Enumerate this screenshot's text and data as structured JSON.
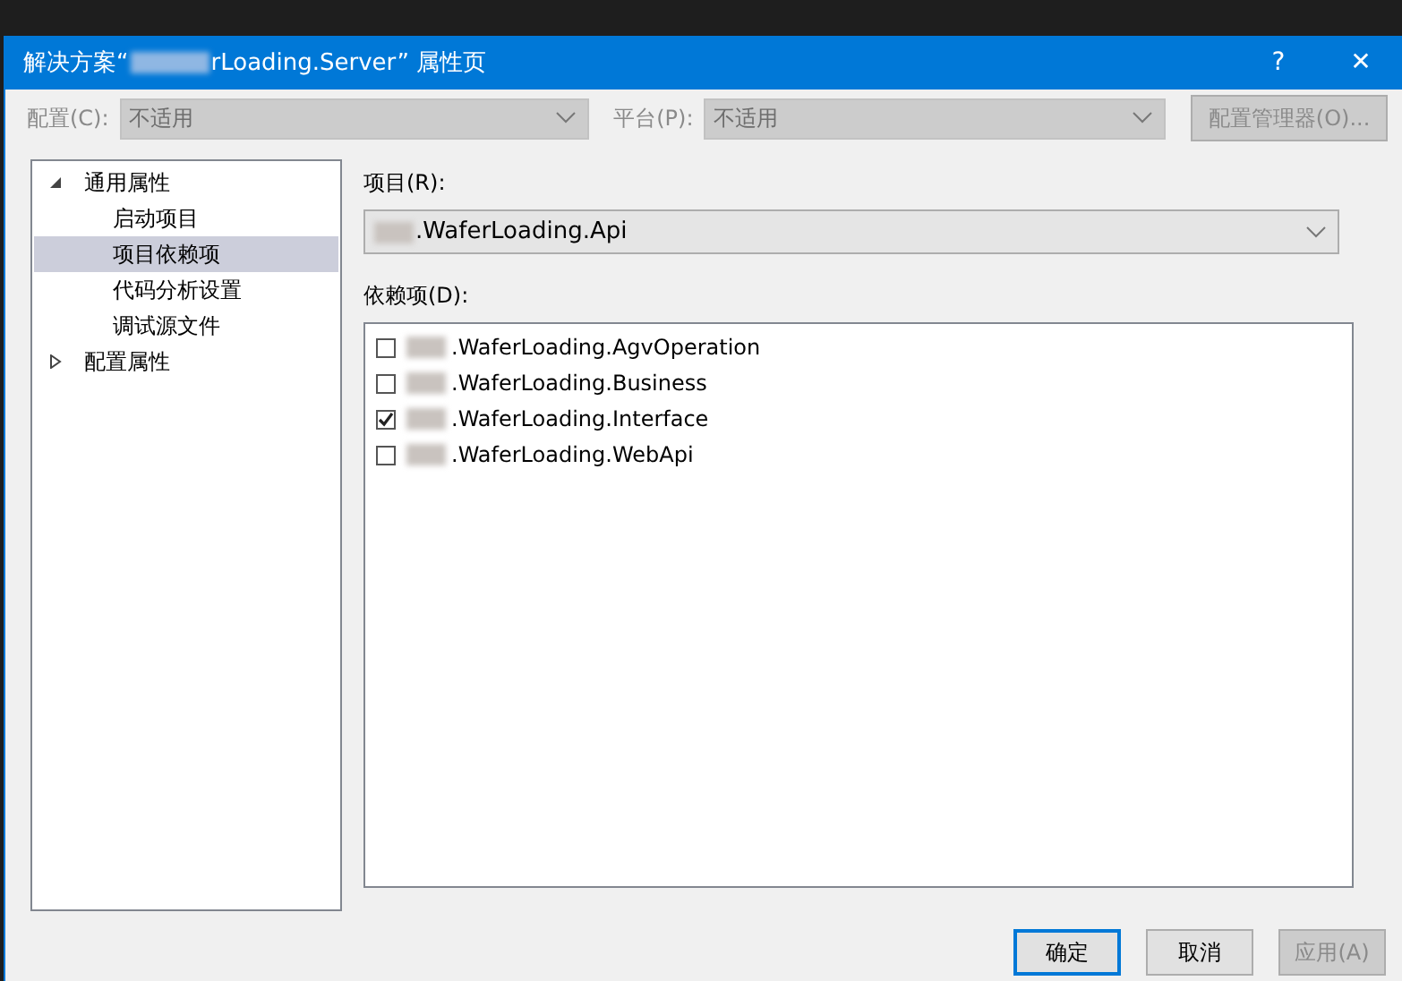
{
  "window": {
    "title_prefix": "解决方案“",
    "title_suffix": "rLoading.Server” 属性页",
    "help": "?",
    "close": "✕"
  },
  "config_row": [
    {
      "label": "配置(C):",
      "value": "不适用",
      "disabled": true
    },
    {
      "label": "平台(P):",
      "value": "不适用",
      "disabled": true
    }
  ],
  "config_manager": {
    "label": "配置管理器(O)...",
    "disabled": true
  },
  "tree": [
    {
      "label": "通用属性",
      "expanded": true,
      "selected": false,
      "children": [
        {
          "label": "启动项目",
          "selected": false
        },
        {
          "label": "项目依赖项",
          "selected": true
        },
        {
          "label": "代码分析设置",
          "selected": false
        },
        {
          "label": "调试源文件",
          "selected": false
        }
      ]
    },
    {
      "label": "配置属性",
      "expanded": false,
      "selected": false
    }
  ],
  "project": {
    "label": "项目(R):",
    "value": ".WaferLoading.Api"
  },
  "dependencies": {
    "label": "依赖项(D):",
    "items": [
      {
        "label": ".WaferLoading.AgvOperation",
        "checked": false
      },
      {
        "label": ".WaferLoading.Business",
        "checked": false
      },
      {
        "label": ".WaferLoading.Interface",
        "checked": true
      },
      {
        "label": ".WaferLoading.WebApi",
        "checked": false
      }
    ]
  },
  "buttons": [
    {
      "label": "确定",
      "default": true,
      "disabled": false
    },
    {
      "label": "取消",
      "default": false,
      "disabled": false
    },
    {
      "label": "应用(A)",
      "default": false,
      "disabled": true
    }
  ]
}
